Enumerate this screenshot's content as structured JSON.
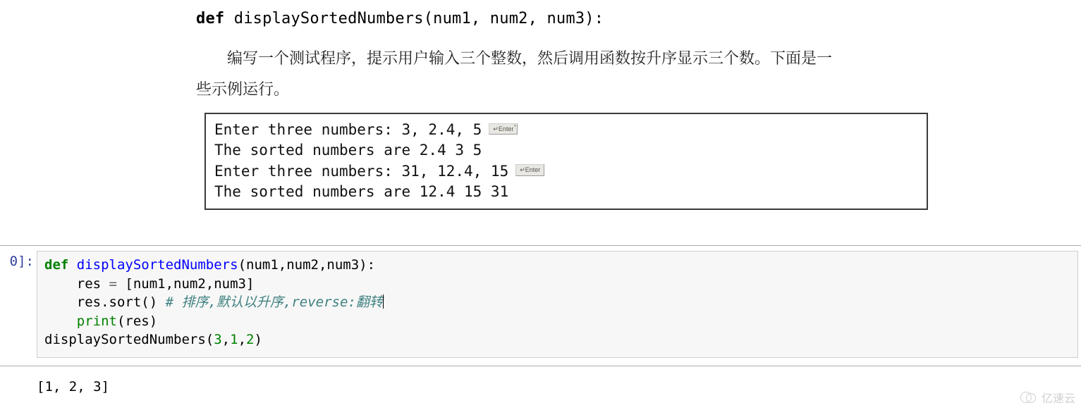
{
  "textbook": {
    "signature_keyword": "def",
    "signature_rest": " displaySortedNumbers(num1, num2, num3):",
    "para_line1": "编写一个测试程序，提示用户输入三个整数，然后调用函数按升序显示三个数。下面是一",
    "para_line2": "些示例运行。",
    "sample": {
      "line1": "Enter three numbers: 3, 2.4, 5",
      "line2": "The sorted numbers are 2.4 3 5",
      "line3": "Enter three numbers: 31, 12.4, 15",
      "line4": "The sorted numbers are 12.4 15 31",
      "enter_label": "↵Enter"
    },
    "tick": "`"
  },
  "jupyter": {
    "prompt": "0]:",
    "code": {
      "l1_kw": "def",
      "l1_rest_a": " ",
      "l1_name": "displaySortedNumbers",
      "l1_rest_b": "(num1,num2,num3):",
      "l2_a": "    res ",
      "l2_op": "=",
      "l2_b": " [num1,num2,num3]",
      "l3_a": "    res",
      "l3_b": ".sort() ",
      "l3_cmt": "# 排序,默认以升序,reverse:翻转",
      "l4_a": "    ",
      "l4_print": "print",
      "l4_b": "(res)",
      "l5_a": "displaySortedNumbers(",
      "l5_n1": "3",
      "l5_c1": ",",
      "l5_n2": "1",
      "l5_c2": ",",
      "l5_n3": "2",
      "l5_b": ")"
    },
    "output": "[1, 2, 3]"
  },
  "watermark": {
    "text": "亿速云"
  }
}
